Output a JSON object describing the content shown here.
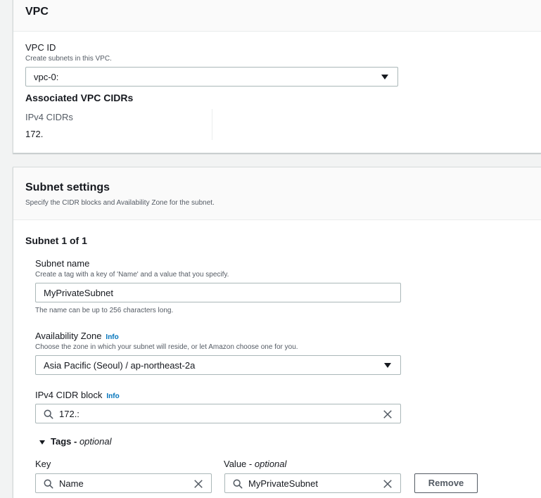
{
  "vpc_section": {
    "title": "VPC",
    "vpc_id_label": "VPC ID",
    "vpc_id_desc": "Create subnets in this VPC.",
    "vpc_id_value": "vpc-0:",
    "assoc_title": "Associated VPC CIDRs",
    "ipv4_cidrs_label": "IPv4 CIDRs",
    "ipv4_cidrs_value": "172."
  },
  "subnet_section": {
    "title": "Subnet settings",
    "desc": "Specify the CIDR blocks and Availability Zone for the subnet.",
    "subnet_heading": "Subnet 1 of 1",
    "name_label": "Subnet name",
    "name_desc": "Create a tag with a key of 'Name' and a value that you specify.",
    "name_value": "MyPrivateSubnet",
    "name_hint": "The name can be up to 256 characters long.",
    "az_label": "Availability Zone",
    "az_info": "Info",
    "az_desc": "Choose the zone in which your subnet will reside, or let Amazon choose one for you.",
    "az_value": "Asia Pacific (Seoul) / ap-northeast-2a",
    "cidr_label": "IPv4 CIDR block",
    "cidr_info": "Info",
    "cidr_value": "172.:",
    "tags_label": "Tags -",
    "tags_optional": "optional",
    "key_label": "Key",
    "value_label": "Value -",
    "value_optional": "optional",
    "key_value": "Name",
    "value_value": "MyPrivateSubnet",
    "remove_label": "Remove"
  },
  "icons": {
    "search": "search-icon",
    "clear": "close-icon",
    "dropdown": "caret-down-icon",
    "expand": "caret-down-icon"
  }
}
